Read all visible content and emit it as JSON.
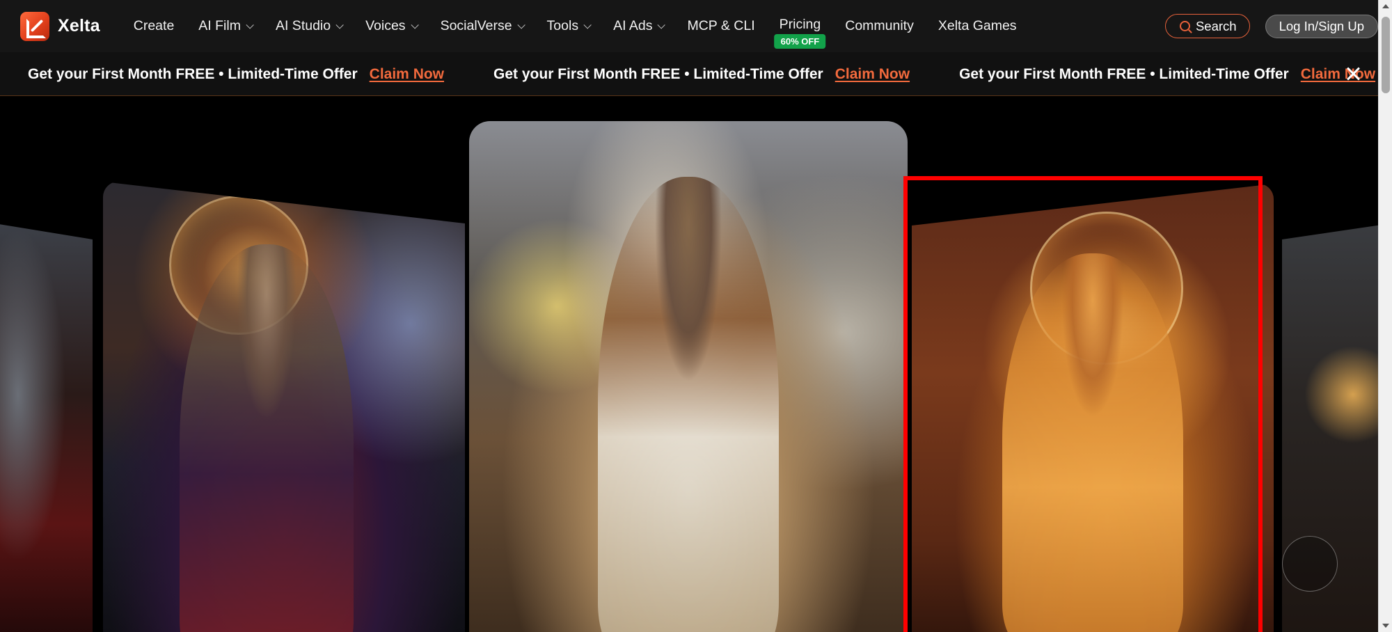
{
  "brand": {
    "name": "Xelta"
  },
  "nav": {
    "items": [
      {
        "label": "Create",
        "dropdown": false
      },
      {
        "label": "AI Film",
        "dropdown": true
      },
      {
        "label": "AI Studio",
        "dropdown": true
      },
      {
        "label": "Voices",
        "dropdown": true
      },
      {
        "label": "SocialVerse",
        "dropdown": true
      },
      {
        "label": "Tools",
        "dropdown": true
      },
      {
        "label": "AI Ads",
        "dropdown": true
      },
      {
        "label": "MCP & CLI",
        "dropdown": false
      }
    ],
    "pricing": {
      "label": "Pricing",
      "badge": "60% OFF"
    },
    "community": "Community",
    "games": "Xelta Games",
    "search_label": "Search",
    "login_label": "Log In/Sign Up"
  },
  "promo": {
    "text": "Get your First Month FREE • Limited-Time Offer",
    "link": "Claim Now"
  },
  "colors": {
    "accent": "#f26a3d",
    "badge": "#12a24a",
    "highlight": "#ff0000"
  }
}
